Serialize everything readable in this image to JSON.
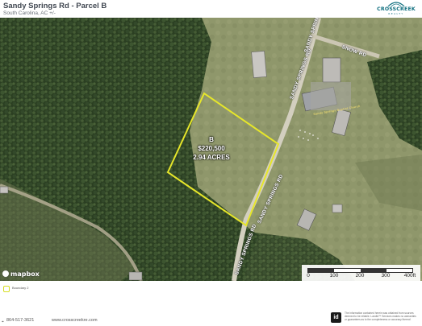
{
  "header": {
    "title": "Sandy Springs Rd - Parcel B",
    "subtitle": "South Carolina,  AC +/-",
    "logo_text": "CROSSCREEK",
    "logo_sub": "REALTY"
  },
  "map": {
    "road_labels": [
      "SANDY SPRINGS RD",
      "SANDY SPRINGS RD",
      "SANDY SPRINGS RD",
      "SANDY SPRINGS RD",
      "SNOW RD"
    ],
    "parcel": {
      "name": "B",
      "price": "$220,500",
      "acreage": "2.94 ACRES",
      "outline_color": "#e6e62a"
    },
    "building_label": "Sandy Springs Baptist Church",
    "attribution": "mapbox"
  },
  "scale_bar": {
    "ticks": [
      "0",
      "100",
      "200",
      "300",
      "400ft"
    ]
  },
  "legend": {
    "items": [
      {
        "label": "Boundary 2",
        "color": "#d6de22"
      }
    ]
  },
  "footer": {
    "phone": "864-517-3621",
    "website": "www.crosscreekre.com",
    "id_badge": "id",
    "disclaimer": "The information contained herein was obtained from sources deemed to be reliable. LandId™ Services makes no warranties or guarantees as to the completeness or accuracy thereof."
  }
}
